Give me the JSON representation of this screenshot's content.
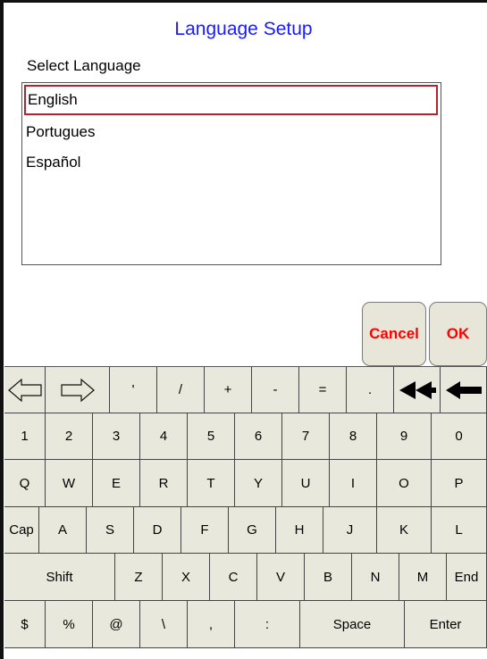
{
  "header": {
    "title": "Language Setup",
    "subtitle": "Select Language"
  },
  "languages": [
    {
      "label": "English",
      "selected": true
    },
    {
      "label": "Portugues",
      "selected": false
    },
    {
      "label": "Español",
      "selected": false
    }
  ],
  "actions": {
    "cancel": "Cancel",
    "ok": "OK"
  },
  "colors": {
    "title": "#1a1aff",
    "action_text": "#ff0000",
    "selection_border": "#b2222f",
    "keyboard_bg": "#e9e8dc"
  },
  "keyboard": {
    "row1": {
      "left_arrow_icon": "outline-left-arrow-icon",
      "right_arrow_icon": "outline-right-arrow-icon",
      "keys": [
        "'",
        "/",
        "+",
        "-",
        "=",
        "."
      ],
      "double_back_icon": "double-left-arrow-icon",
      "backspace_icon": "backspace-arrow-icon"
    },
    "row2": [
      "1",
      "2",
      "3",
      "4",
      "5",
      "6",
      "7",
      "8",
      "9",
      "0"
    ],
    "row3": [
      "Q",
      "W",
      "E",
      "R",
      "T",
      "Y",
      "U",
      "I",
      "O",
      "P"
    ],
    "row4": [
      "Cap",
      "A",
      "S",
      "D",
      "F",
      "G",
      "H",
      "J",
      "K",
      "L"
    ],
    "row5": [
      "Shift",
      "Z",
      "X",
      "C",
      "V",
      "B",
      "N",
      "M",
      "End"
    ],
    "row6": [
      "$",
      "%",
      "@",
      "\\",
      ",",
      ":",
      "Space",
      "Enter"
    ]
  }
}
